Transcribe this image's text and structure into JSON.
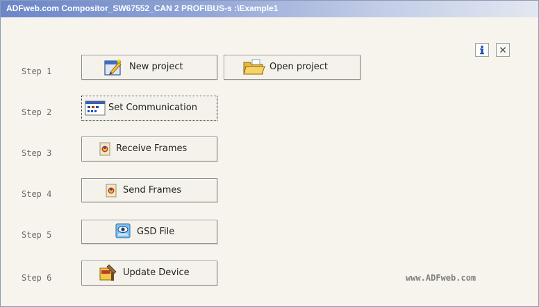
{
  "window": {
    "title": "ADFweb.com Compositor_SW67552_CAN 2 PROFIBUS-s :\\Example1"
  },
  "steps": [
    {
      "label": "Step 1"
    },
    {
      "label": "Step 2"
    },
    {
      "label": "Step 3"
    },
    {
      "label": "Step 4"
    },
    {
      "label": "Step 5"
    },
    {
      "label": "Step 6"
    }
  ],
  "buttons": {
    "new_project": {
      "label": "New project",
      "icon": "new-project-icon"
    },
    "open_project": {
      "label": "Open project",
      "icon": "folder-icon"
    },
    "set_communication": {
      "label": "Set Communication",
      "icon": "communication-icon"
    },
    "receive_frames": {
      "label": "Receive Frames",
      "icon": "frame-icon"
    },
    "send_frames": {
      "label": "Send Frames",
      "icon": "frame-icon"
    },
    "gsd_file": {
      "label": "GSD File",
      "icon": "gsd-file-icon"
    },
    "update_device": {
      "label": "Update Device",
      "icon": "update-device-icon"
    }
  },
  "top_right": {
    "info_icon": "info-icon",
    "close_icon": "close-icon"
  },
  "footer": {
    "website": "www.ADFweb.com"
  },
  "colors": {
    "background": "#f6f4ec",
    "titlebar_start": "#6b86c8",
    "titlebar_end": "#e3e7f1"
  }
}
